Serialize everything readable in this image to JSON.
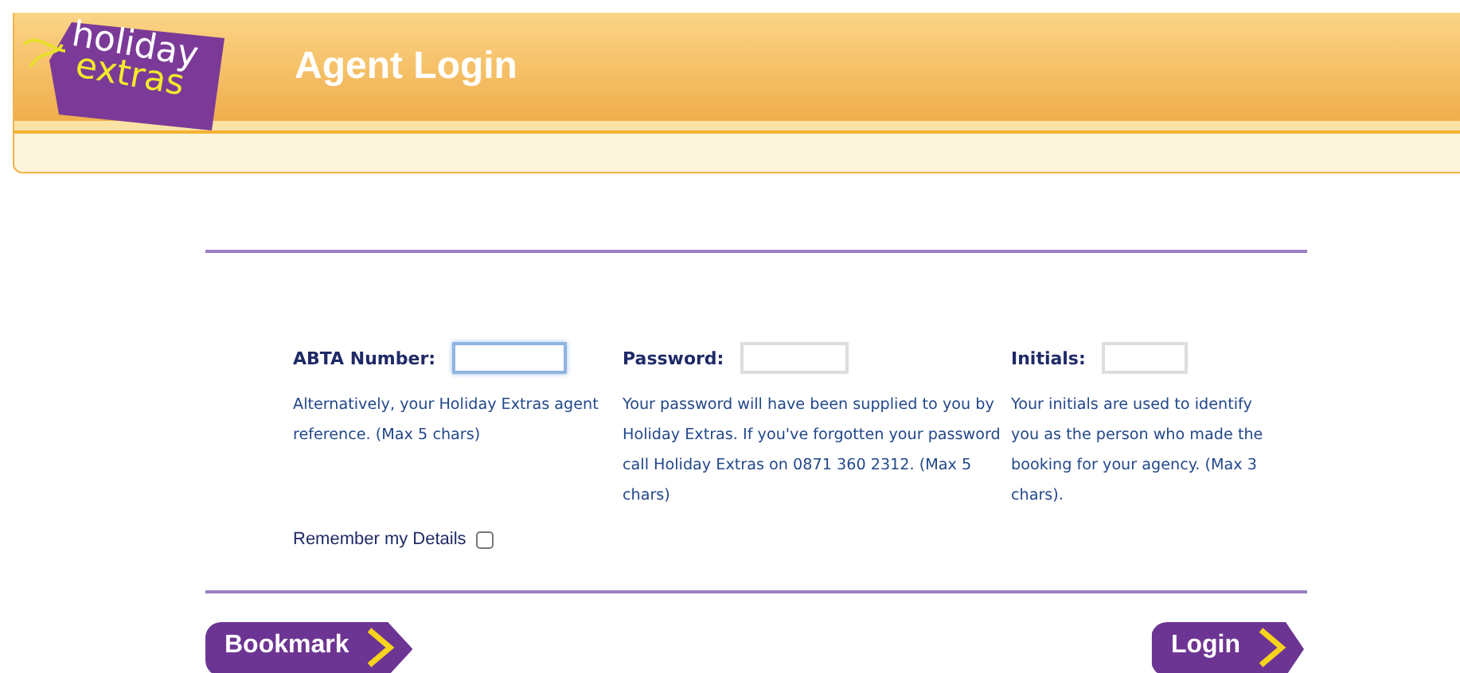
{
  "logo": {
    "line_1": "holiday",
    "line_2": "extras"
  },
  "header": {
    "title": "Agent Login"
  },
  "fields": [
    {
      "label": "ABTA Number:",
      "focused": true,
      "help": "Alternatively, your Holiday Extras agent reference. (Max 5 chars)"
    },
    {
      "label": "Password:",
      "focused": false,
      "help": "Your password will have been supplied to you by Holiday Extras. If you've forgotten your password call Holiday Extras on 0871 360 2312. (Max 5 chars)"
    },
    {
      "label": "Initials:",
      "focused": false,
      "help": "Your initials are used to identify you as the person who made the booking for your agency. (Max 3 chars)."
    }
  ],
  "remember": {
    "label": "Remember my Details",
    "checked": false
  },
  "buttons": [
    "Bookmark",
    "Login"
  ]
}
